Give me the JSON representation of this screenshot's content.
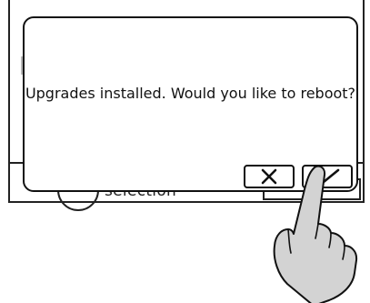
{
  "dialog": {
    "message": "Upgrades installed. Would you like to reboot?",
    "cancel_icon": "close-icon",
    "confirm_icon": "checkmark-icon"
  },
  "background": {
    "label": "selection"
  },
  "colors": {
    "outline": "#111111",
    "hand_fill": "#d3d3d3",
    "marker": "#b8b8b8"
  }
}
